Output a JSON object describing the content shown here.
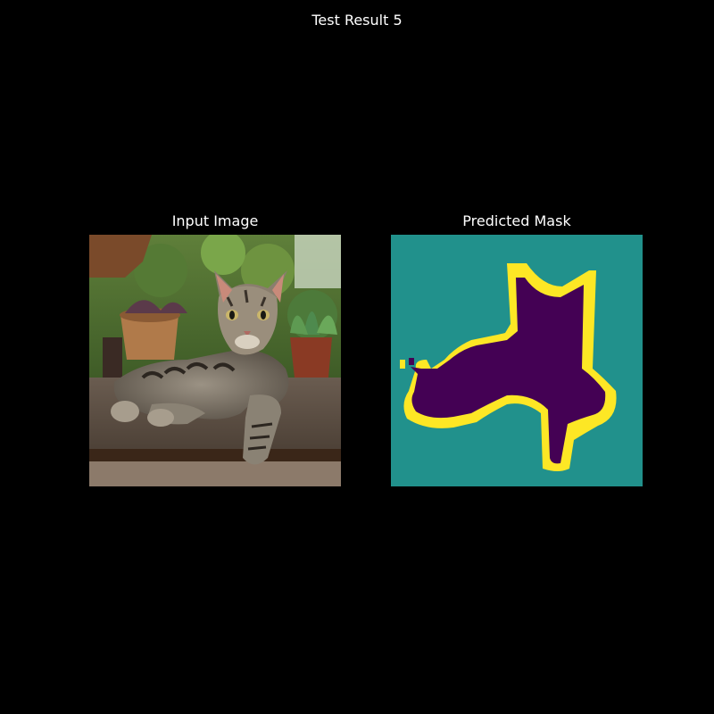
{
  "figure": {
    "title": "Test Result 5"
  },
  "panels": [
    {
      "title": "Input Image",
      "content": "photo of a tabby cat lying on a wooden board, potted plants behind"
    },
    {
      "title": "Predicted Mask",
      "content": "segmentation mask"
    }
  ],
  "mask_colors": {
    "background": "#21918c",
    "boundary": "#fde725",
    "foreground": "#440154"
  }
}
